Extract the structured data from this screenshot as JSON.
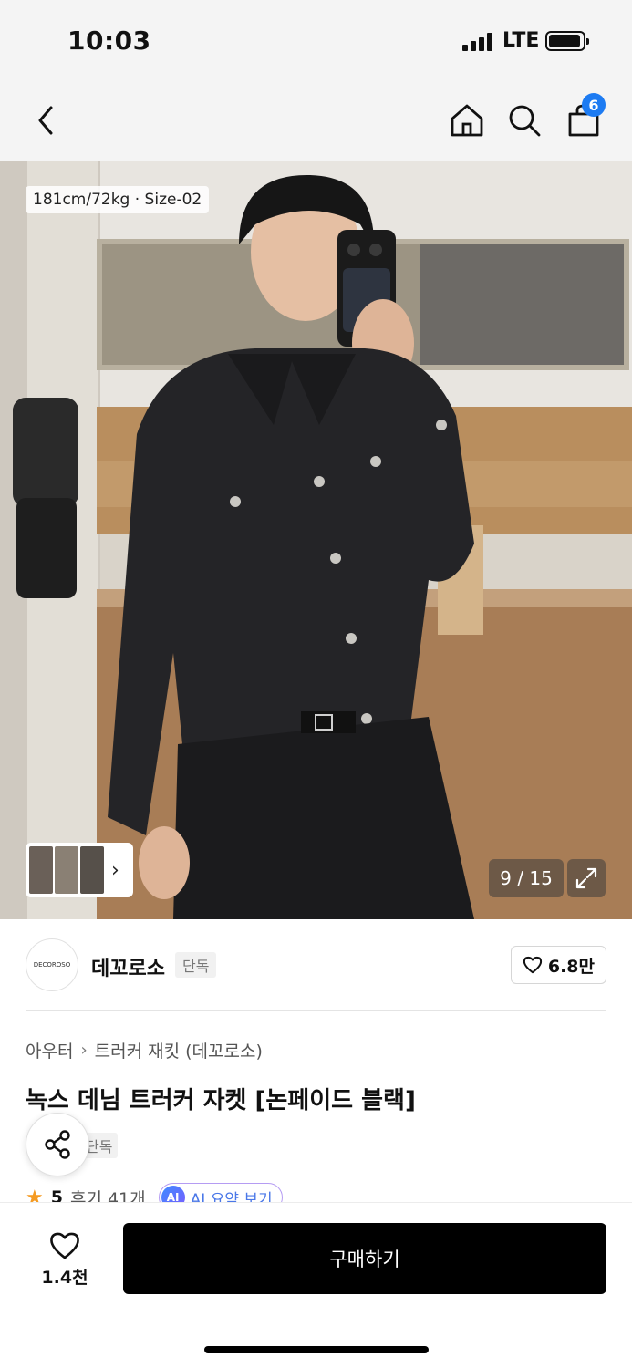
{
  "status_bar": {
    "time": "10:03",
    "network": "LTE"
  },
  "nav": {
    "cart_count": "6"
  },
  "hero": {
    "model_info": "181cm/72kg · Size-02",
    "counter": "9 / 15",
    "thumbs_chevron": "›"
  },
  "brand": {
    "logo_text": "DECOROSO",
    "name": "데꼬로소",
    "tag": "단독",
    "like_count": "6.8만"
  },
  "product": {
    "breadcrumb": [
      "아우터",
      "트러커 재킷 (데꼬로소)"
    ],
    "breadcrumb_sep": "›",
    "title": "녹스 데님 트러커 자켓 [논페이드 블랙]",
    "tag": "단독",
    "rating": "5",
    "review_count": "후기 41개",
    "ai_badge": "AI",
    "ai_label": "AI 요약 보기"
  },
  "bottom": {
    "wish_count": "1.4천",
    "buy_label": "구매하기"
  },
  "colors": {
    "accent_badge": "#1d7bf2",
    "star": "#f59b23",
    "buy_button": "#000000"
  }
}
